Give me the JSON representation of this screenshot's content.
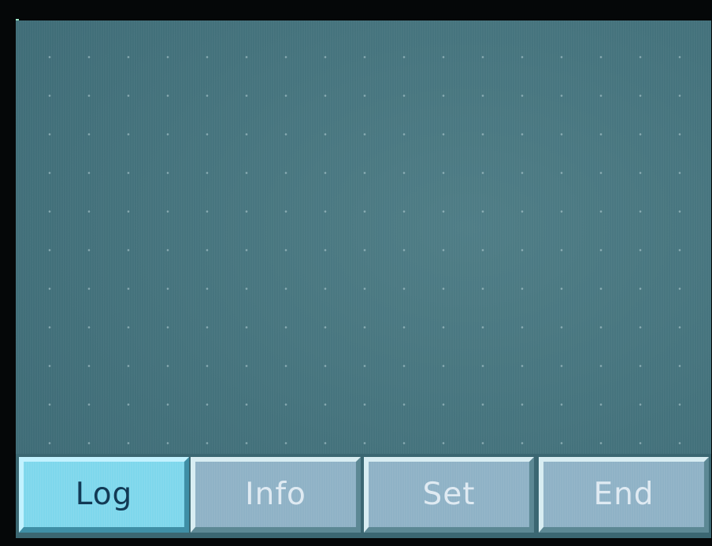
{
  "screen": {
    "background_color": "#44727c"
  },
  "button_bar": {
    "buttons": [
      {
        "label": "Log",
        "state": "active"
      },
      {
        "label": "Info",
        "state": "inactive"
      },
      {
        "label": "Set",
        "state": "inactive"
      },
      {
        "label": "End",
        "state": "inactive"
      }
    ],
    "active_color": "#7ed7ec",
    "inactive_color": "#8fb2c6"
  }
}
